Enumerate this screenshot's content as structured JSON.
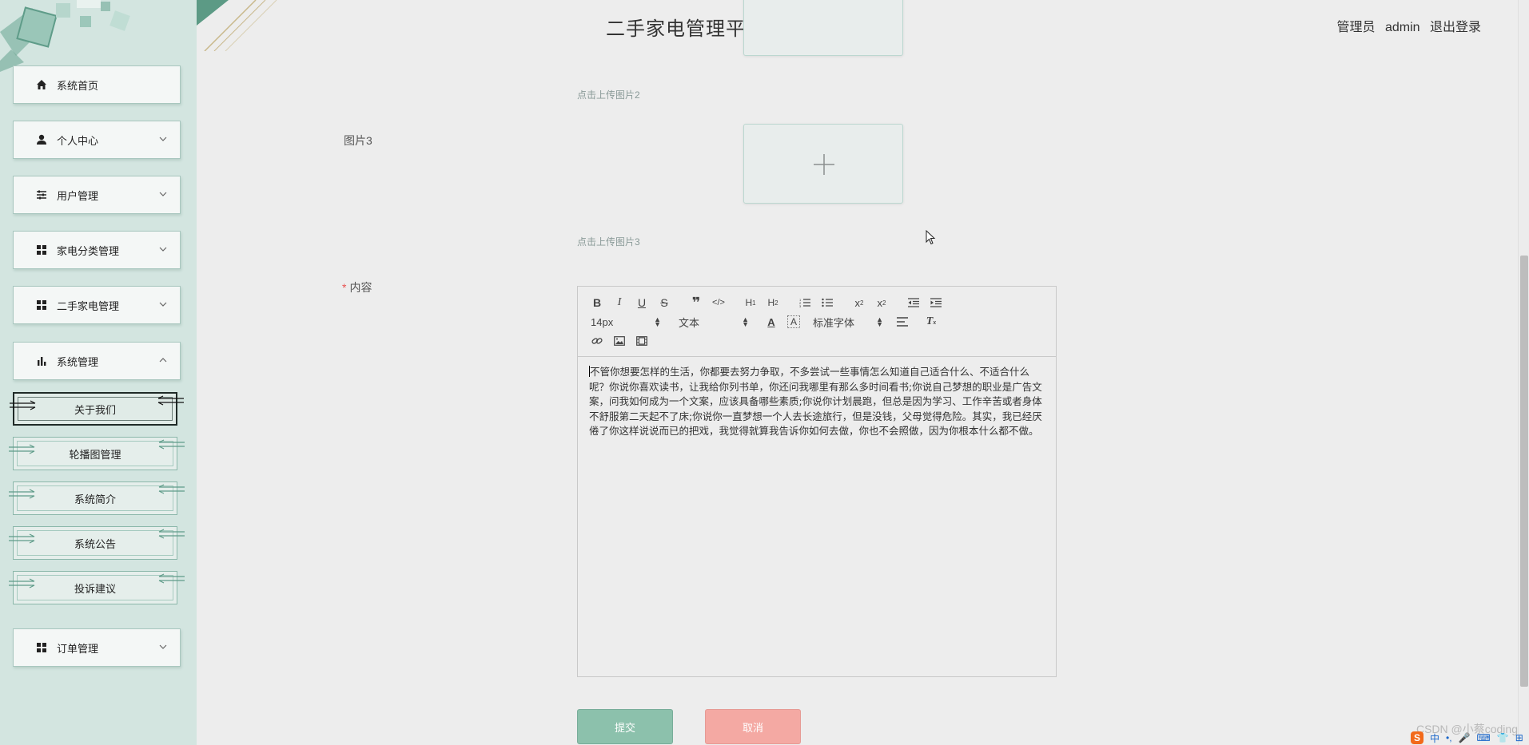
{
  "header": {
    "title": "二手家电管理平台",
    "role": "管理员",
    "username": "admin",
    "logout_label": "退出登录"
  },
  "sidebar": {
    "items": [
      {
        "label": "系统首页",
        "icon": "home-icon"
      },
      {
        "label": "个人中心",
        "icon": "user-icon"
      },
      {
        "label": "用户管理",
        "icon": "sliders-icon"
      },
      {
        "label": "家电分类管理",
        "icon": "grid-icon"
      },
      {
        "label": "二手家电管理",
        "icon": "grid-icon"
      },
      {
        "label": "系统管理",
        "icon": "bar-chart-icon"
      },
      {
        "label": "订单管理",
        "icon": "grid-icon"
      }
    ],
    "sub_items": [
      "关于我们",
      "轮播图管理",
      "系统简介",
      "系统公告",
      "投诉建议"
    ],
    "active_sub_item": "关于我们"
  },
  "form": {
    "upload2_hint": "点击上传图片2",
    "picture3_label": "图片3",
    "upload3_hint": "点击上传图片3",
    "content_label": "内容",
    "required_mark": "*",
    "editor": {
      "font_size": "14px",
      "block_type": "文本",
      "font_family": "标准字体",
      "content": "不管你想要怎样的生活，你都要去努力争取，不多尝试一些事情怎么知道自己适合什么、不适合什么呢？你说你喜欢读书，让我给你列书单，你还问我哪里有那么多时间看书;你说自己梦想的职业是广告文案，问我如何成为一个文案，应该具备哪些素质;你说你计划晨跑，但总是因为学习、工作辛苦或者身体不舒服第二天起不了床;你说你一直梦想一个人去长途旅行，但是没钱，父母觉得危险。其实，我已经厌倦了你这样说说而已的把戏，我觉得就算我告诉你如何去做，你也不会照做，因为你根本什么都不做。"
    },
    "submit_label": "提交",
    "cancel_label": "取消"
  },
  "watermark": "CSDN @小蔡coding",
  "ime": {
    "lang": "中"
  },
  "colors": {
    "sidebar_bg": "#d3e5e0",
    "accent": "#8cc1ac",
    "cancel": "#f4a9a3",
    "required": "#e8504f"
  }
}
